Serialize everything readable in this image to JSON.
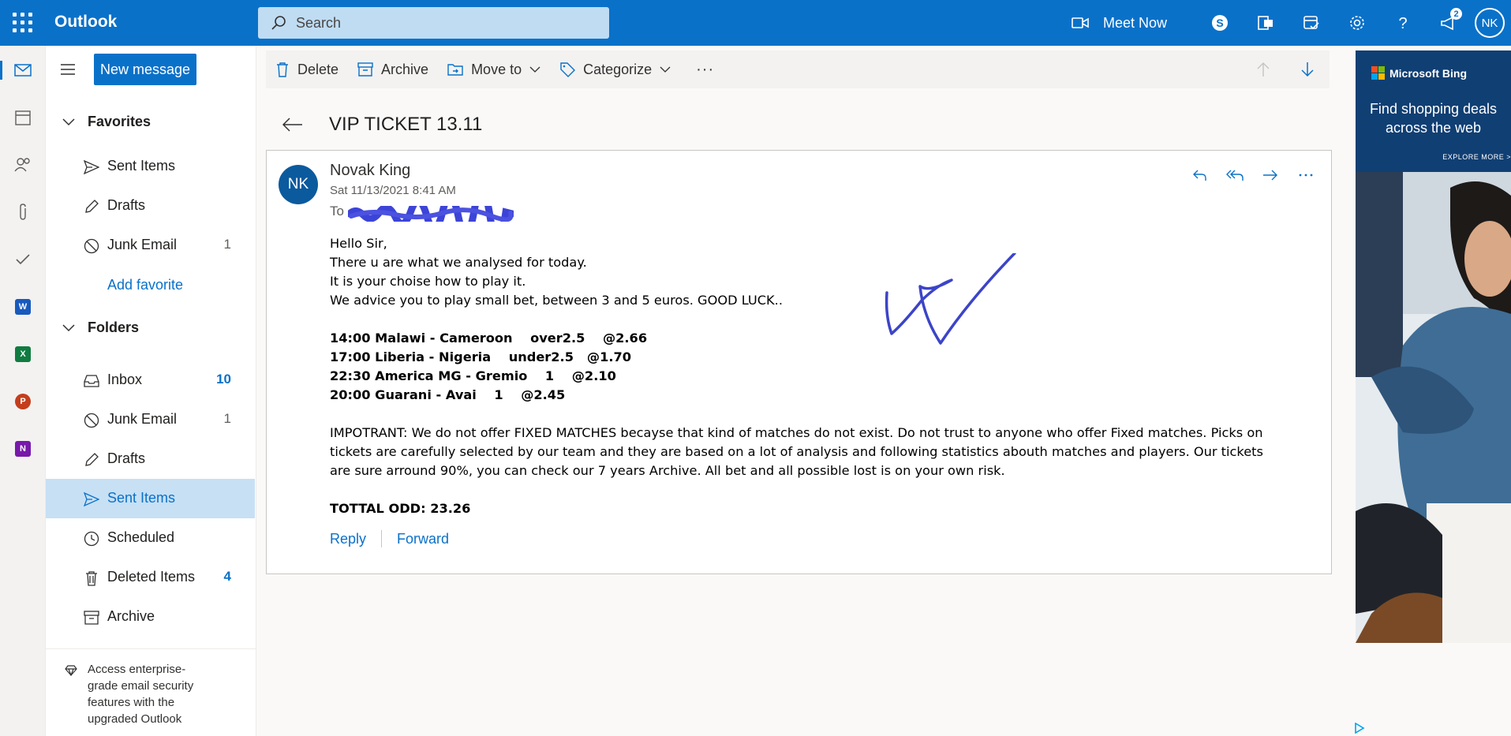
{
  "app": {
    "name": "Outlook"
  },
  "search": {
    "placeholder": "Search"
  },
  "topbar": {
    "meet_now": "Meet Now",
    "notifications_count": "2",
    "avatar_initials": "NK",
    "accent": "#0a71c9"
  },
  "toolbar": {
    "new_message": "New message"
  },
  "favorites": {
    "header": "Favorites",
    "items": [
      {
        "label": "Sent Items",
        "icon": "send-icon",
        "count": ""
      },
      {
        "label": "Drafts",
        "icon": "pencil-icon",
        "count": ""
      },
      {
        "label": "Junk Email",
        "icon": "block-icon",
        "count": "1"
      }
    ],
    "add_favorite": "Add favorite"
  },
  "folders": {
    "header": "Folders",
    "items": [
      {
        "label": "Inbox",
        "icon": "inbox-icon",
        "count": "10"
      },
      {
        "label": "Junk Email",
        "icon": "block-icon",
        "count": "1"
      },
      {
        "label": "Drafts",
        "icon": "pencil-icon",
        "count": ""
      },
      {
        "label": "Sent Items",
        "icon": "send-icon",
        "count": "",
        "selected": true
      },
      {
        "label": "Scheduled",
        "icon": "clock-icon",
        "count": ""
      },
      {
        "label": "Deleted Items",
        "icon": "trash-icon",
        "count": "4"
      },
      {
        "label": "Archive",
        "icon": "archive-icon",
        "count": ""
      }
    ]
  },
  "upsell": {
    "text": "Access enterprise-grade email security features with the upgraded Outlook"
  },
  "commands": {
    "delete": "Delete",
    "archive": "Archive",
    "move_to": "Move to",
    "categorize": "Categorize",
    "more": "···"
  },
  "message": {
    "subject": "VIP TICKET 13.11",
    "sender_initials": "NK",
    "sender": "Novak King",
    "date": "Sat 11/13/2021 8:41 AM",
    "to_label": "To",
    "body_lines": [
      "Hello Sir,",
      "There u are what we analysed for today.",
      "It is your choise how to play it.",
      "We advice you to play small bet, between 3 and 5 euros. GOOD LUCK.."
    ],
    "picks": [
      "14:00 Malawi - Cameroon    over2.5    @2.66",
      "17:00 Liberia - Nigeria    under2.5   @1.70",
      "22:30 America MG - Gremio    1    @2.10",
      "20:00 Guarani - Avai    1    @2.45"
    ],
    "disclaimer": "IMPOTRANT: We do not offer FIXED MATCHES becayse that kind of matches do not exist. Do not trust to anyone who offer Fixed matches. Picks on tickets are carefully selected by our team and they are based on a lot of analysis and following statistics abouth matches and players. Our tickets are sure arround 90%, you can check our 7 years Archive. All bet and all possible lost is on your own risk.",
    "total": "TOTTAL ODD: 23.26",
    "reply": "Reply",
    "forward": "Forward"
  },
  "ad": {
    "brand": "Microsoft Bing",
    "headline": "Find shopping deals across the web",
    "cta": "EXPLORE MORE >"
  }
}
